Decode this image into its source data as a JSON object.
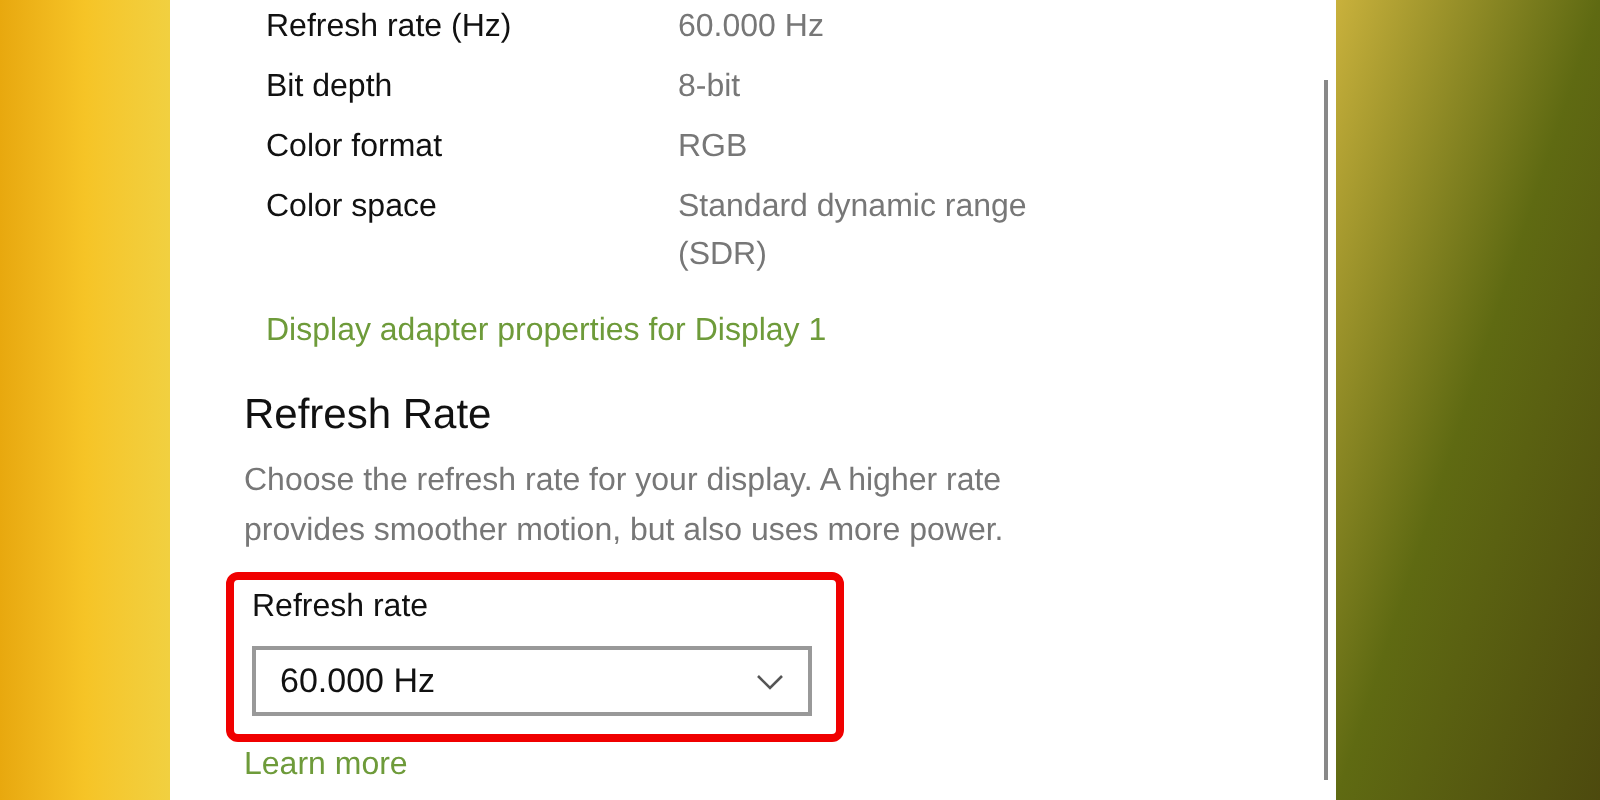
{
  "properties": [
    {
      "label": "Refresh rate (Hz)",
      "value": [
        "60.000 Hz"
      ]
    },
    {
      "label": "Bit depth",
      "value": [
        "8-bit"
      ]
    },
    {
      "label": "Color format",
      "value": [
        "RGB"
      ]
    },
    {
      "label": "Color space",
      "value": [
        "Standard dynamic range",
        "(SDR)"
      ]
    }
  ],
  "adapter_link": "Display adapter properties for Display 1",
  "section": {
    "title": "Refresh Rate",
    "description": [
      "Choose the refresh rate for your display. A higher rate",
      "provides smoother motion, but also uses more power."
    ],
    "field": {
      "label": "Refresh rate",
      "value": "60.000 Hz",
      "highlighted": true
    },
    "link": "Learn more"
  }
}
